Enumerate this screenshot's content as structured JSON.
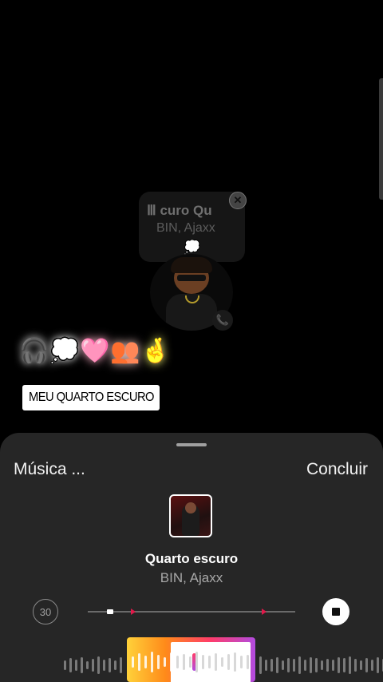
{
  "music_sticker": {
    "title": "Ⅲ curo     Qu",
    "artist": "BIN, Ajaxx",
    "thought_icon": "thought-bubble-icon"
  },
  "emoji_row": [
    "🎧",
    "💭",
    "🩷",
    "👥",
    "🤞"
  ],
  "location": {
    "text": "MEU QUARTO ESCURO",
    "pin_color": "#e0194a"
  },
  "sheet": {
    "title": "Música ...",
    "done_label": "Concluir",
    "song_title": "Quarto escuro",
    "song_artist": "BIN, Ajaxx",
    "duration_label": "30",
    "accent_color": "#e0194a",
    "selector_gradient": [
      "#ffd23a",
      "#ff8a1a",
      "#ff3c6a",
      "#b24be0"
    ]
  }
}
